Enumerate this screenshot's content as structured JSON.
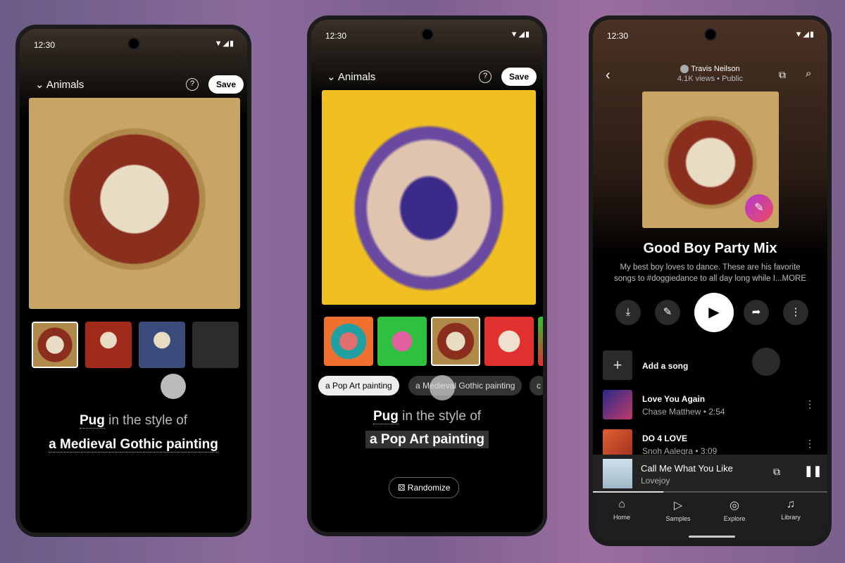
{
  "status_time": "12:30",
  "phone1": {
    "collection": "Animals",
    "save": "Save",
    "help": "?",
    "prompt_subject": "Pug",
    "prompt_connector": "in the style of",
    "prompt_style": "a Medieval Gothic painting"
  },
  "phone2": {
    "collection": "Animals",
    "save": "Save",
    "help": "?",
    "chips": [
      "a Pop Art painting",
      "a Medieval Gothic painting",
      "c"
    ],
    "prompt_subject": "Pug",
    "prompt_connector": "in the style of",
    "prompt_style": "a Pop Art painting",
    "randomize": "Randomize"
  },
  "phone3": {
    "owner": "Travis Neilson",
    "views": "4.1K views",
    "visibility": "Public",
    "title": "Good Boy Party Mix",
    "description_line1": "My best boy loves to dance. These are his favorite",
    "description_line2": "songs to #doggiedance to all day long while I...MORE",
    "add_song": "Add a song",
    "songs": [
      {
        "title": "Love You Again",
        "subtitle": "Chase Matthew • 2:54"
      },
      {
        "title": "DO 4 LOVE",
        "subtitle": "Snoh Aalegra • 3:09"
      }
    ],
    "now_playing": {
      "title": "Call Me What You Like",
      "artist": "Lovejoy",
      "progress": 0.3
    },
    "nav": [
      {
        "label": "Home",
        "icon": "home-icon"
      },
      {
        "label": "Samples",
        "icon": "samples-icon"
      },
      {
        "label": "Explore",
        "icon": "compass-icon"
      },
      {
        "label": "Library",
        "icon": "library-icon"
      }
    ],
    "accent": "#e0358a"
  }
}
